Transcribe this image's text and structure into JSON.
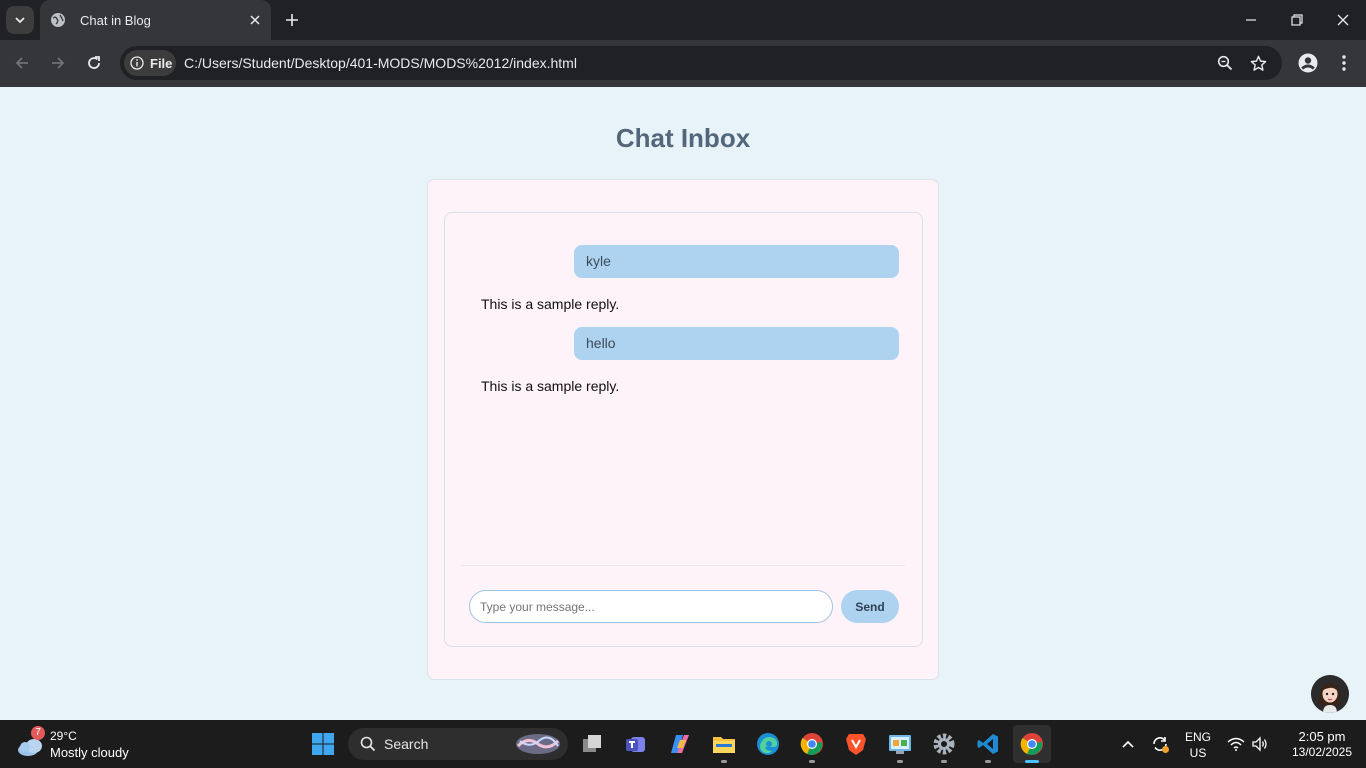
{
  "browser": {
    "tab_title": "Chat in Blog",
    "file_chip": "File",
    "url": "C:/Users/Student/Desktop/401-MODS/MODS%2012/index.html"
  },
  "page": {
    "title": "Chat Inbox",
    "messages": [
      {
        "type": "sent",
        "text": "kyle"
      },
      {
        "type": "reply",
        "text": "This is a sample reply."
      },
      {
        "type": "sent",
        "text": "hello"
      },
      {
        "type": "reply",
        "text": "This is a sample reply."
      }
    ],
    "input_placeholder": "Type your message...",
    "send_label": "Send"
  },
  "taskbar": {
    "weather_badge": "7",
    "weather_temp": "29°C",
    "weather_desc": "Mostly cloudy",
    "search_label": "Search",
    "lang_top": "ENG",
    "lang_bottom": "US",
    "time": "2:05 pm",
    "date": "13/02/2025"
  },
  "colors": {
    "page_bg": "#e7f3f8",
    "card_bg": "#fdf3f8",
    "bubble": "#aed3f1",
    "title": "#53667a"
  }
}
